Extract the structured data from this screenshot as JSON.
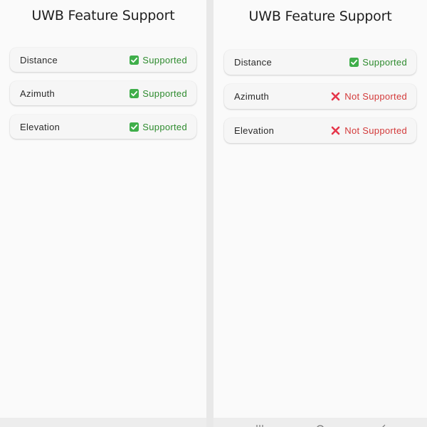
{
  "panels": [
    {
      "title": "UWB Feature Support",
      "features": [
        {
          "label": "Distance",
          "status": "Supported",
          "supported": true
        },
        {
          "label": "Azimuth",
          "status": "Supported",
          "supported": true
        },
        {
          "label": "Elevation",
          "status": "Supported",
          "supported": true
        }
      ]
    },
    {
      "title": "UWB Feature Support",
      "features": [
        {
          "label": "Distance",
          "status": "Supported",
          "supported": true
        },
        {
          "label": "Azimuth",
          "status": "Not Supported",
          "supported": false
        },
        {
          "label": "Elevation",
          "status": "Not Supported",
          "supported": false
        }
      ]
    }
  ],
  "colors": {
    "supported": "#2e8b2e",
    "not_supported": "#d33a3a",
    "check_box": "#3fae4a",
    "cross": "#e5364a"
  },
  "icons": {
    "supported": "check-mark-button-icon",
    "not_supported": "cross-mark-icon",
    "nav_recents": "recents-icon",
    "nav_home": "home-icon",
    "nav_back": "back-icon"
  }
}
